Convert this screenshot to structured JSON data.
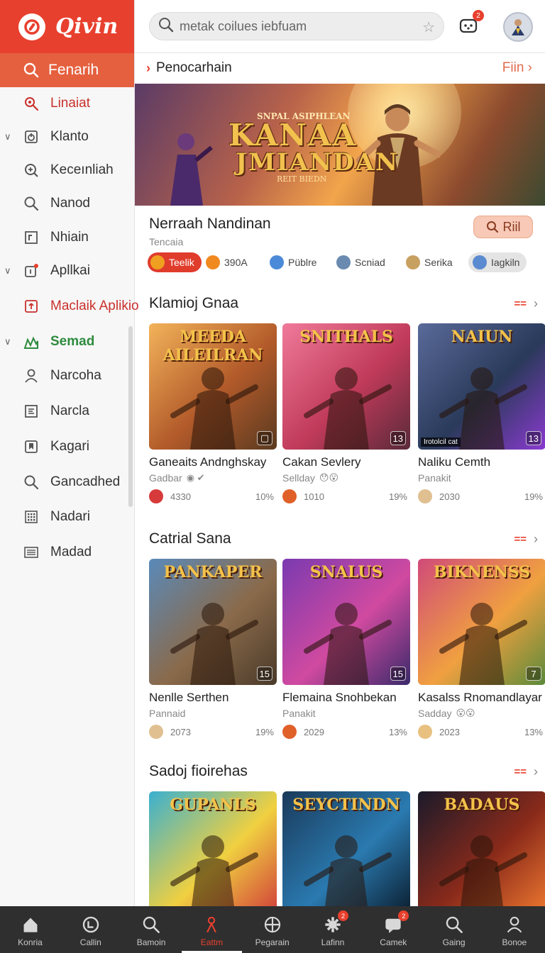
{
  "app": {
    "name": "Qivin",
    "logo_icon": "app-logo-icon"
  },
  "sidebar": {
    "search_label": "Fenarih",
    "items": [
      {
        "label": "Linaiat",
        "icon": "search-gear-icon",
        "style": "red",
        "chevron": false
      },
      {
        "label": "Klanto",
        "icon": "power-box-icon",
        "style": "normal",
        "chevron": true
      },
      {
        "label": "Keceınliah",
        "icon": "search-plus-icon",
        "style": "normal",
        "chevron": false
      },
      {
        "label": "Nanod",
        "icon": "search-icon",
        "style": "normal",
        "chevron": false
      },
      {
        "label": "Nhiain",
        "icon": "frame-icon",
        "style": "normal",
        "chevron": false
      },
      {
        "label": "Apllkai",
        "icon": "app-badge-icon",
        "style": "normal",
        "chevron": true
      },
      {
        "label": "Maclaik Aplikio",
        "icon": "plus-box-icon",
        "style": "red",
        "chevron": false
      },
      {
        "label": "Semad",
        "icon": "chart-icon",
        "style": "green",
        "chevron": true
      },
      {
        "label": "Narcoha",
        "icon": "user-icon",
        "style": "normal",
        "chevron": false
      },
      {
        "label": "Narcla",
        "icon": "list-box-icon",
        "style": "normal",
        "chevron": false
      },
      {
        "label": "Kagari",
        "icon": "bookmark-box-icon",
        "style": "normal",
        "chevron": false
      },
      {
        "label": "Gancadhed",
        "icon": "search-icon",
        "style": "normal",
        "chevron": false
      },
      {
        "label": "Nadari",
        "icon": "grid-icon",
        "style": "normal",
        "chevron": false
      },
      {
        "label": "Madad",
        "icon": "news-icon",
        "style": "normal",
        "chevron": false
      }
    ]
  },
  "topbar": {
    "search_value": "metak coilues iebfuam",
    "notif_badge": "2"
  },
  "breadcrumb": {
    "label": "Penocarhain",
    "link": "Fiin"
  },
  "hero": {
    "title_line1": "KANAA",
    "title_line2": "JMIANDAN",
    "top_text": "SNPAL ASIPHLEAN",
    "subtitle": "REIT BIEDN"
  },
  "featured": {
    "title": "Nerraah Nandinan",
    "subtitle": "Tencaia",
    "button_label": "Riil",
    "chips": [
      {
        "label": "Teelik",
        "color": "#f0a020"
      },
      {
        "label": "390A",
        "color": "#f08a20"
      },
      {
        "label": "Püblre",
        "color": "#4a8ad8"
      },
      {
        "label": "Scniad",
        "color": "#6a8ab0"
      },
      {
        "label": "Serika",
        "color": "#c8a060"
      },
      {
        "label": "Iagkiln",
        "color": "#5a8ad0"
      }
    ]
  },
  "sections": [
    {
      "title": "Klamioj Gnaa",
      "more": "==",
      "games": [
        {
          "name": "Ganeaits Andnghskay",
          "publisher": "Gadbar",
          "count": "4330",
          "percent": "10%",
          "logo": "MEEDA AILEILRAN",
          "corner": "▢",
          "tag": "",
          "art_colors": [
            "#f3b35a",
            "#b25a2a",
            "#5a3a20"
          ],
          "face": "#d63a3a",
          "pub_emoji": "◉ ✔"
        },
        {
          "name": "Cakan Sevlery",
          "publisher": "Sellday",
          "count": "1010",
          "percent": "19%",
          "logo": "SNITHALS",
          "corner": "13",
          "tag": "",
          "art_colors": [
            "#f07a9a",
            "#c03a5a",
            "#5a2a3a"
          ],
          "face": "#e0602a",
          "pub_emoji": "😯😮"
        },
        {
          "name": "Naliku Cemth",
          "publisher": "Panakit",
          "count": "2030",
          "percent": "19%",
          "logo": "NAIUN",
          "corner": "13",
          "tag": "Irotolcil cat",
          "art_colors": [
            "#5a6a9a",
            "#2a3a5a",
            "#8a3ad0"
          ],
          "face": "#e0c090",
          "pub_emoji": ""
        }
      ]
    },
    {
      "title": "Catrial Sana",
      "more": "==",
      "games": [
        {
          "name": "Nenlle Serthen",
          "publisher": "Pannaid",
          "count": "2073",
          "percent": "19%",
          "logo": "PANKAPER",
          "corner": "15",
          "tag": "",
          "art_colors": [
            "#5a8aba",
            "#8a6a4a",
            "#4a3a2a"
          ],
          "face": "#e0c090",
          "pub_emoji": ""
        },
        {
          "name": "Flemaina Snohbekan",
          "publisher": "Panakit",
          "count": "2029",
          "percent": "13%",
          "logo": "SNALUS",
          "corner": "15",
          "tag": "",
          "art_colors": [
            "#7a3ab0",
            "#d04aa0",
            "#3a2a6a"
          ],
          "face": "#e0602a",
          "pub_emoji": ""
        },
        {
          "name": "Kasalss Rnomandlayar",
          "publisher": "Sadday",
          "count": "2023",
          "percent": "13%",
          "logo": "BIKNENSS",
          "corner": "7",
          "tag": "",
          "art_colors": [
            "#d04a7a",
            "#f0a040",
            "#5a8a3a"
          ],
          "face": "#e8c080",
          "pub_emoji": "😮😮"
        }
      ]
    },
    {
      "title": "Sadoj fioirehas",
      "more": "==",
      "games": [
        {
          "name": "",
          "publisher": "",
          "count": "",
          "percent": "",
          "logo": "GUPANLS",
          "corner": "",
          "tag": "",
          "art_colors": [
            "#3ab0d0",
            "#f0d040",
            "#d03a3a"
          ],
          "face": "",
          "pub_emoji": ""
        },
        {
          "name": "",
          "publisher": "",
          "count": "",
          "percent": "",
          "logo": "SEYCTINDN",
          "corner": "",
          "tag": "",
          "art_colors": [
            "#1a3a5a",
            "#2a7ab0",
            "#0a1a2a"
          ],
          "face": "",
          "pub_emoji": ""
        },
        {
          "name": "",
          "publisher": "",
          "count": "",
          "percent": "",
          "logo": "BADAUS",
          "corner": "",
          "tag": "",
          "art_colors": [
            "#1a1a2a",
            "#8a2a1a",
            "#f07a30"
          ],
          "face": "",
          "pub_emoji": ""
        }
      ]
    }
  ],
  "bottom_nav": [
    {
      "label": "Konria",
      "icon": "home-icon",
      "badge": ""
    },
    {
      "label": "Callin",
      "icon": "clock-icon",
      "badge": ""
    },
    {
      "label": "Bamoin",
      "icon": "search-icon",
      "badge": ""
    },
    {
      "label": "Eattm",
      "icon": "person-icon",
      "badge": "",
      "active": true
    },
    {
      "label": "Pegarain",
      "icon": "crosshair-icon",
      "badge": ""
    },
    {
      "label": "Lafinn",
      "icon": "gear-icon",
      "badge": "2"
    },
    {
      "label": "Camek",
      "icon": "chat-icon",
      "badge": "2"
    },
    {
      "label": "Gaing",
      "icon": "search-icon",
      "badge": ""
    },
    {
      "label": "Bonoe",
      "icon": "user-icon",
      "badge": ""
    }
  ]
}
